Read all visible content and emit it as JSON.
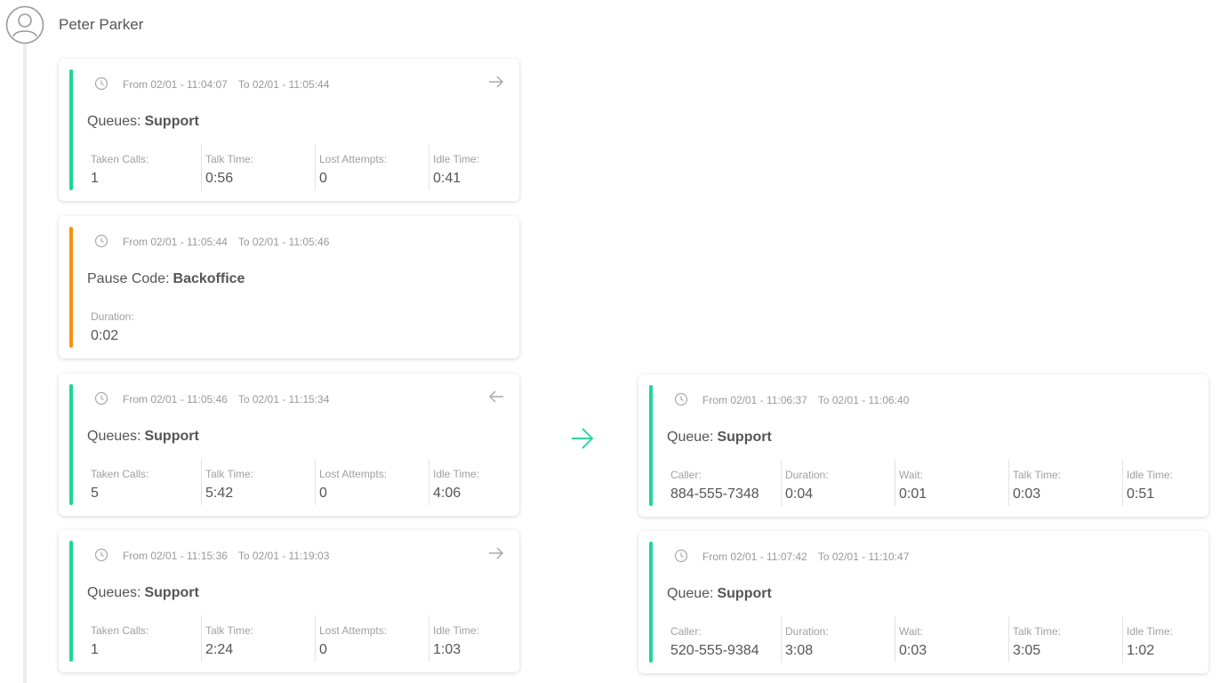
{
  "agent": {
    "name": "Peter Parker",
    "avatar_icon": "user-avatar-icon"
  },
  "colors": {
    "queue": "#1fd59a",
    "pause": "#f39214",
    "arrow": "#2fd8a0"
  },
  "left_cards": [
    {
      "type": "queue",
      "from": "From 02/01 - 11:04:07",
      "to": "To 02/01 - 11:05:44",
      "nav": "arrow-right-icon",
      "label": "Queues:",
      "value": "Support",
      "stats": [
        {
          "label": "Taken Calls:",
          "value": "1"
        },
        {
          "label": "Talk Time:",
          "value": "0:56"
        },
        {
          "label": "Lost Attempts:",
          "value": "0"
        },
        {
          "label": "Idle Time:",
          "value": "0:41"
        }
      ]
    },
    {
      "type": "pause",
      "from": "From 02/01 - 11:05:44",
      "to": "To 02/01 - 11:05:46",
      "label": "Pause Code:",
      "value": "Backoffice",
      "stats": [
        {
          "label": "Duration:",
          "value": "0:02"
        }
      ]
    },
    {
      "type": "queue",
      "from": "From 02/01 - 11:05:46",
      "to": "To 02/01 - 11:15:34",
      "nav": "arrow-left-icon",
      "label": "Queues:",
      "value": "Support",
      "stats": [
        {
          "label": "Taken Calls:",
          "value": "5"
        },
        {
          "label": "Talk Time:",
          "value": "5:42"
        },
        {
          "label": "Lost Attempts:",
          "value": "0"
        },
        {
          "label": "Idle Time:",
          "value": "4:06"
        }
      ]
    },
    {
      "type": "queue",
      "from": "From 02/01 - 11:15:36",
      "to": "To 02/01 - 11:19:03",
      "nav": "arrow-right-icon",
      "label": "Queues:",
      "value": "Support",
      "stats": [
        {
          "label": "Taken Calls:",
          "value": "1"
        },
        {
          "label": "Talk Time:",
          "value": "2:24"
        },
        {
          "label": "Lost Attempts:",
          "value": "0"
        },
        {
          "label": "Idle Time:",
          "value": "1:03"
        }
      ]
    }
  ],
  "right_cards": [
    {
      "from": "From 02/01 - 11:06:37",
      "to": "To 02/01 - 11:06:40",
      "label": "Queue:",
      "value": "Support",
      "stats": [
        {
          "label": "Caller:",
          "value": "884-555-7348"
        },
        {
          "label": "Duration:",
          "value": "0:04"
        },
        {
          "label": "Wait:",
          "value": "0:01"
        },
        {
          "label": "Talk Time:",
          "value": "0:03"
        },
        {
          "label": "Idle Time:",
          "value": "0:51"
        }
      ]
    },
    {
      "from": "From 02/01 - 11:07:42",
      "to": "To 02/01 - 11:10:47",
      "label": "Queue:",
      "value": "Support",
      "stats": [
        {
          "label": "Caller:",
          "value": "520-555-9384"
        },
        {
          "label": "Duration:",
          "value": "3:08"
        },
        {
          "label": "Wait:",
          "value": "0:03"
        },
        {
          "label": "Talk Time:",
          "value": "3:05"
        },
        {
          "label": "Idle Time:",
          "value": "1:02"
        }
      ]
    }
  ]
}
